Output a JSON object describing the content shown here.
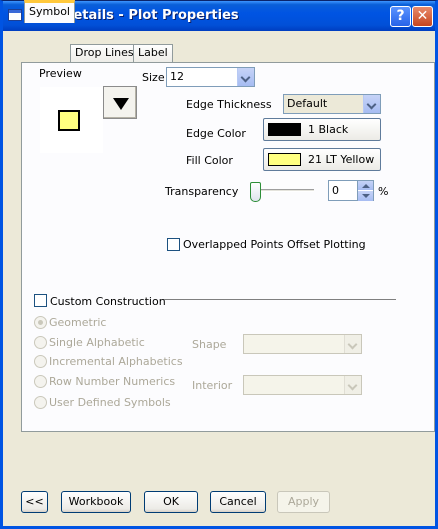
{
  "window": {
    "title": "Plot Details - Plot Properties",
    "help_label": "?",
    "close_label": "✕"
  },
  "tabs": [
    {
      "label": "Symbol",
      "active": true
    },
    {
      "label": "Drop Lines",
      "active": false
    },
    {
      "label": "Label",
      "active": false
    }
  ],
  "symbol": {
    "preview_label": "Preview",
    "size_label": "Size",
    "size_value": "12",
    "edge_thickness_label": "Edge Thickness",
    "edge_thickness_value": "Default",
    "edge_color_label": "Edge Color",
    "edge_color_value": "1 Black",
    "edge_color_hex": "#000000",
    "fill_color_label": "Fill Color",
    "fill_color_value": "21 LT Yellow",
    "fill_color_hex": "#ffff80",
    "transparency_label": "Transparency",
    "transparency_value": "0",
    "transparency_unit": "%",
    "overlapped_label": "Overlapped Points Offset Plotting",
    "custom_construction_label": "Custom Construction",
    "options": [
      {
        "label": "Geometric",
        "selected": true
      },
      {
        "label": "Single Alphabetic",
        "selected": false
      },
      {
        "label": "Incremental Alphabetics",
        "selected": false
      },
      {
        "label": "Row Number Numerics",
        "selected": false
      },
      {
        "label": "User Defined Symbols",
        "selected": false
      }
    ],
    "shape_label": "Shape",
    "interior_label": "Interior"
  },
  "buttons": {
    "collapse": "<<",
    "workbook": "Workbook",
    "ok": "OK",
    "cancel": "Cancel",
    "apply": "Apply"
  }
}
